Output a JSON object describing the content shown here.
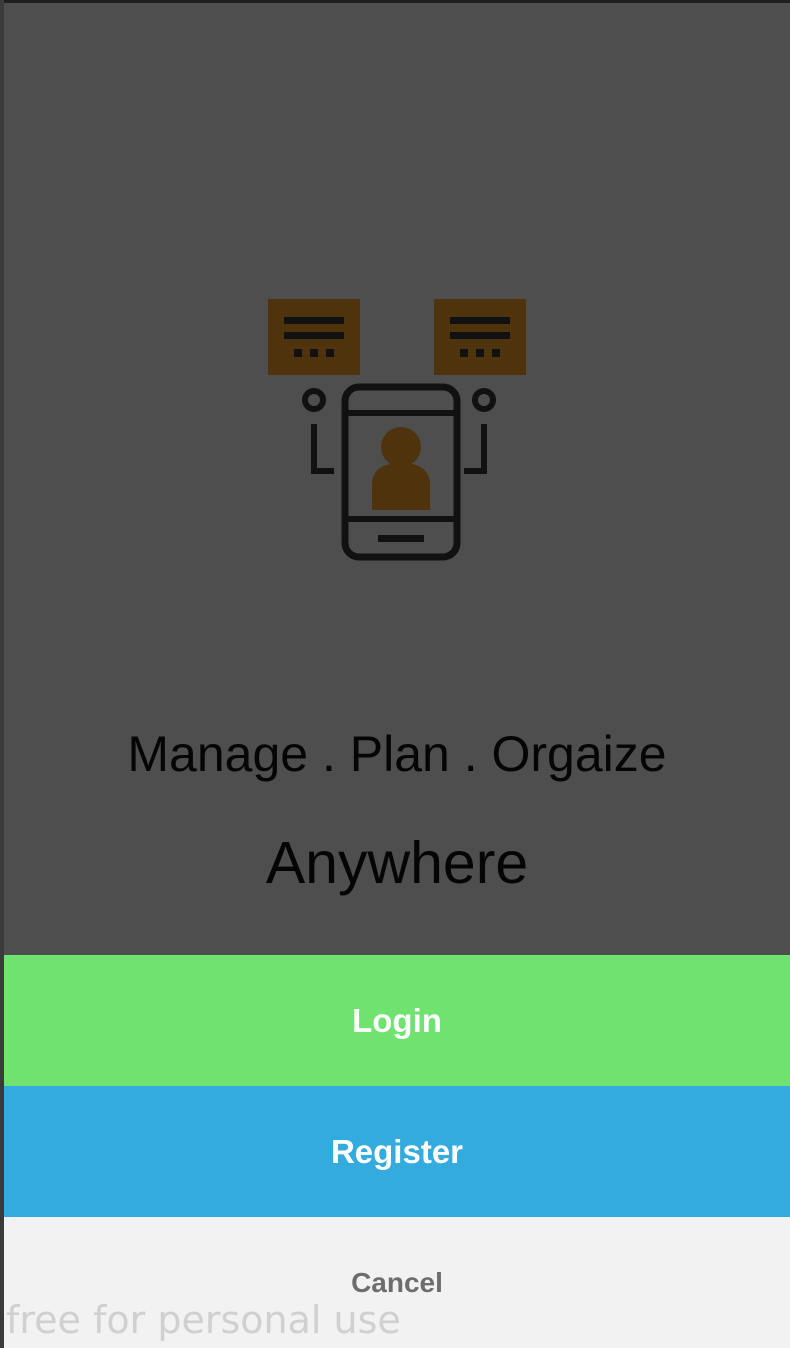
{
  "tagline": {
    "line1": "Manage . Plan . Orgaize",
    "line2": "Anywhere"
  },
  "buttons": {
    "login_label": "Login",
    "register_label": "Register",
    "cancel_label": "Cancel"
  },
  "watermark": {
    "text": "free for personal use"
  },
  "illustration": {
    "icon": "phone-contact-icon"
  },
  "colors": {
    "login": "#6fe270",
    "register": "#33abdf",
    "cancel": "#f2f2f2",
    "overlay": "#4e4e4e",
    "accent_brown": "#4f330d"
  }
}
